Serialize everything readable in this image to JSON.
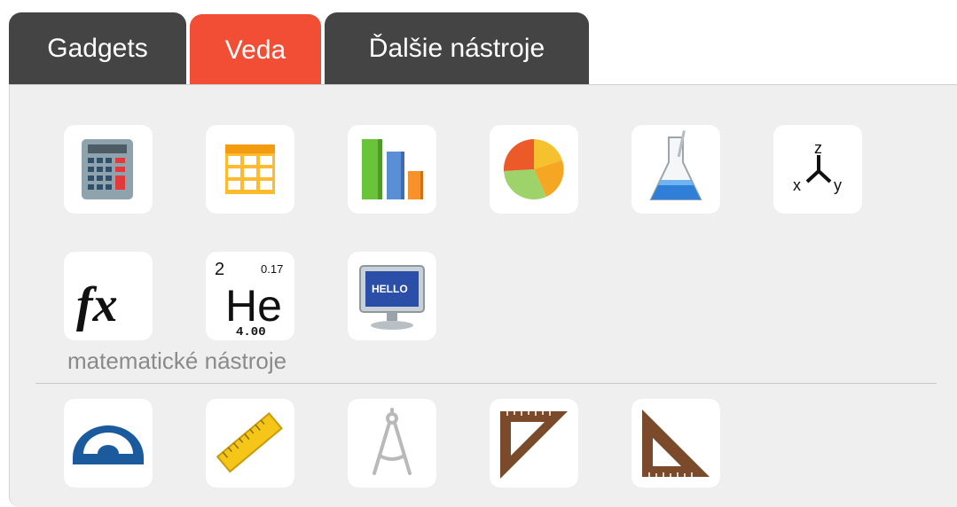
{
  "tabs": [
    {
      "label": "Gadgets"
    },
    {
      "label": "Veda"
    },
    {
      "label": "Ďalšie nástroje"
    }
  ],
  "active_tab": "Veda",
  "science_tools": [
    {
      "icon": "calculator-icon"
    },
    {
      "icon": "spreadsheet-icon"
    },
    {
      "icon": "bar-chart-icon"
    },
    {
      "icon": "pie-chart-icon"
    },
    {
      "icon": "flask-icon"
    },
    {
      "icon": "xyz-axes-icon",
      "text": {
        "z": "z",
        "x": "x",
        "y": "y"
      }
    },
    {
      "icon": "function-fx-icon",
      "text": "fx"
    },
    {
      "icon": "periodic-element-icon",
      "text": {
        "number": "2",
        "symbol": "He",
        "top_right": "0.17",
        "mass": "4.00"
      }
    },
    {
      "icon": "monitor-hello-icon",
      "text": "HELLO"
    }
  ],
  "math_section": {
    "label": "matematické nástroje",
    "tools": [
      {
        "icon": "protractor-icon"
      },
      {
        "icon": "ruler-icon"
      },
      {
        "icon": "compass-icon"
      },
      {
        "icon": "set-square-icon"
      },
      {
        "icon": "triangle-ruler-icon"
      }
    ]
  },
  "colors": {
    "tab_bg": "#444444",
    "tab_active_bg": "#f24e35",
    "panel_bg": "#efefef",
    "label_gray": "#8a8a8a"
  }
}
